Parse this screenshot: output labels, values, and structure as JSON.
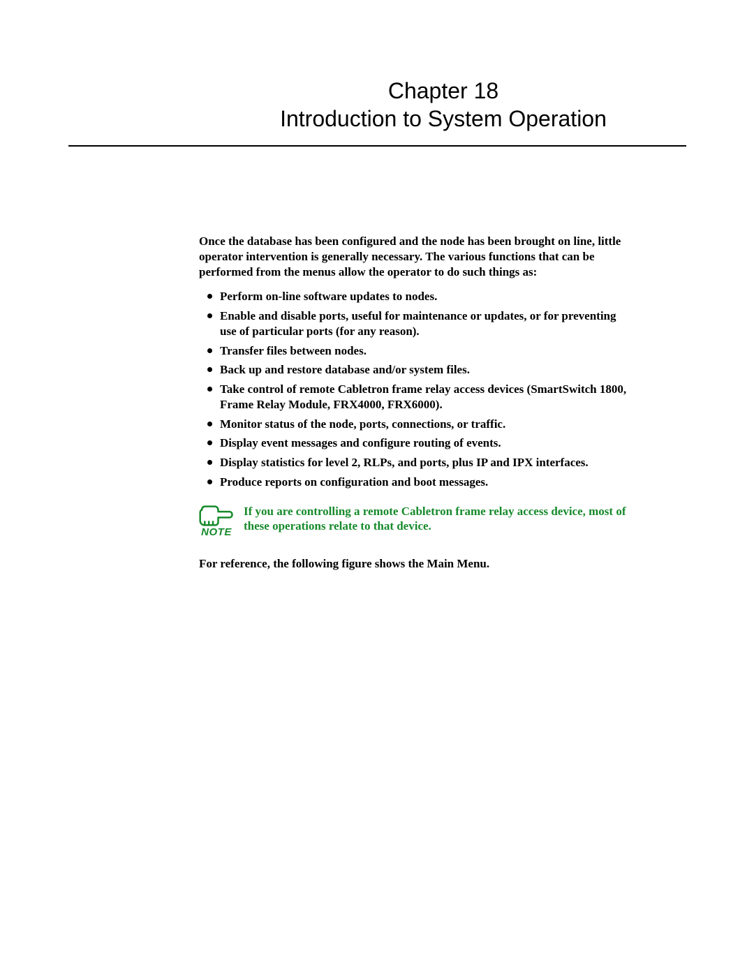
{
  "chapter": {
    "line1": "Chapter 18",
    "line2": "Introduction to System Operation"
  },
  "intro": "Once the database has been configured and the node has been brought on line, little operator intervention is generally necessary. The various functions that can be performed from the menus allow the operator to do such things as:",
  "bullets": [
    "Perform on-line software updates to nodes.",
    "Enable and disable ports, useful for maintenance or updates, or for preventing use of particular ports (for any reason).",
    "Transfer files between nodes.",
    "Back up and restore database and/or system files.",
    "Take control of remote Cabletron frame relay access devices (SmartSwitch 1800, Frame Relay Module, FRX4000, FRX6000).",
    "Monitor status of the node, ports, connections, or traffic.",
    "Display event messages and configure routing of events.",
    "Display statistics for level 2, RLPs, and ports, plus IP and IPX interfaces.",
    "Produce reports on configuration and boot messages."
  ],
  "note": {
    "label": "NOTE",
    "text": "If you are controlling a remote Cabletron frame relay access device, most of these operations relate to that device."
  },
  "reference": "For reference, the following figure shows the Main Menu.",
  "colors": {
    "note_green": "#168a2b"
  }
}
